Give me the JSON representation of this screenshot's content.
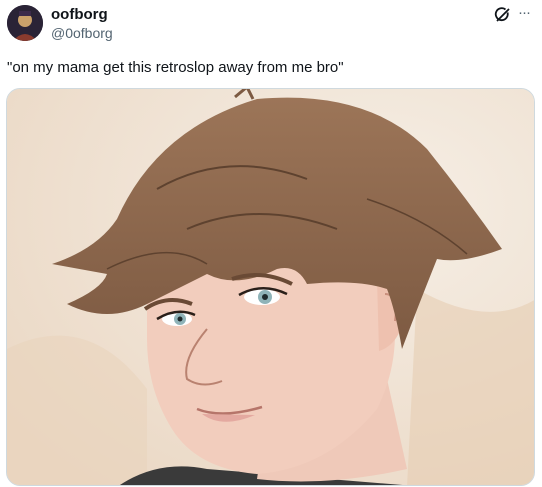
{
  "tweet": {
    "display_name": "oofborg",
    "handle": "@0ofborg",
    "text": "\"on my mama get this retroslop away from me bro\""
  },
  "icons": {
    "grok": "grok-icon",
    "more": "more-horizontal-icon",
    "avatar": "user-avatar"
  },
  "colors": {
    "text_primary": "#0f1419",
    "text_secondary": "#536471",
    "border": "#cfd9de"
  }
}
